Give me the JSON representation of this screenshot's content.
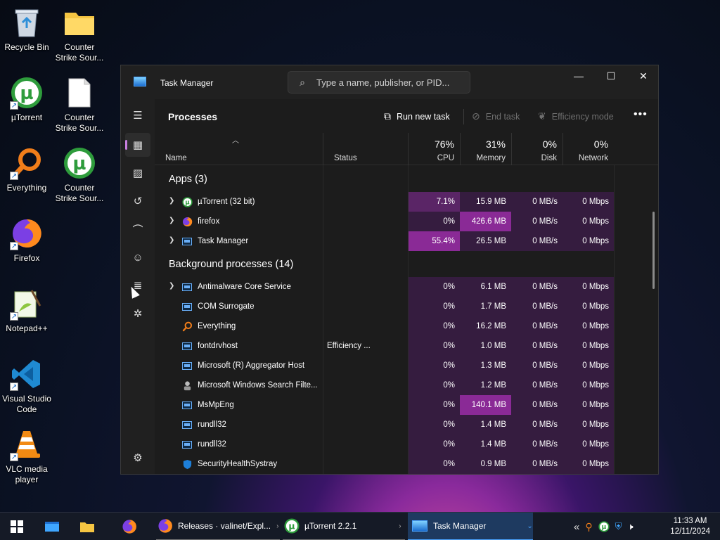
{
  "desktop": {
    "icons": [
      {
        "label": "Recycle Bin",
        "icon": "recycle-bin-icon"
      },
      {
        "label": "Counter Strike Sour...",
        "icon": "folder-icon"
      },
      {
        "label": "µTorrent",
        "icon": "utorrent-icon"
      },
      {
        "label": "Counter Strike Sour...",
        "icon": "document-icon"
      },
      {
        "label": "Everything",
        "icon": "everything-icon"
      },
      {
        "label": "Counter Strike Sour...",
        "icon": "utorrent-icon"
      },
      {
        "label": "Firefox",
        "icon": "firefox-icon"
      },
      {
        "label": "Notepad++",
        "icon": "notepad-plus-plus-icon"
      },
      {
        "label": "Visual Studio Code",
        "icon": "vscode-icon"
      },
      {
        "label": "VLC media player",
        "icon": "vlc-icon"
      }
    ]
  },
  "window": {
    "title": "Task Manager",
    "search_placeholder": "Type a name, publisher, or PID...",
    "controls": {
      "minimize": "—",
      "maximize": "☐",
      "close": "✕"
    }
  },
  "toolbar": {
    "heading": "Processes",
    "run_new_task": "Run new task",
    "end_task": "End task",
    "efficiency_mode": "Efficiency mode",
    "more": "•••"
  },
  "columns": {
    "name": "Name",
    "status": "Status",
    "cpu": {
      "pct": "76%",
      "label": "CPU"
    },
    "memory": {
      "pct": "31%",
      "label": "Memory"
    },
    "disk": {
      "pct": "0%",
      "label": "Disk"
    },
    "network": {
      "pct": "0%",
      "label": "Network"
    }
  },
  "groups": {
    "apps": "Apps (3)",
    "background": "Background processes (14)"
  },
  "apps": [
    {
      "name": "µTorrent (32 bit)",
      "status": "",
      "cpu": "7.1%",
      "memory": "15.9 MB",
      "disk": "0 MB/s",
      "network": "0 Mbps"
    },
    {
      "name": "firefox",
      "status": "",
      "cpu": "0%",
      "memory": "426.6 MB",
      "disk": "0 MB/s",
      "network": "0 Mbps"
    },
    {
      "name": "Task Manager",
      "status": "",
      "cpu": "55.4%",
      "memory": "26.5 MB",
      "disk": "0 MB/s",
      "network": "0 Mbps"
    }
  ],
  "background": [
    {
      "name": "Antimalware Core Service",
      "status": "",
      "cpu": "0%",
      "memory": "6.1 MB",
      "disk": "0 MB/s",
      "network": "0 Mbps"
    },
    {
      "name": "COM Surrogate",
      "status": "",
      "cpu": "0%",
      "memory": "1.7 MB",
      "disk": "0 MB/s",
      "network": "0 Mbps"
    },
    {
      "name": "Everything",
      "status": "",
      "cpu": "0%",
      "memory": "16.2 MB",
      "disk": "0 MB/s",
      "network": "0 Mbps"
    },
    {
      "name": "fontdrvhost",
      "status": "Efficiency ...",
      "cpu": "0%",
      "memory": "1.0 MB",
      "disk": "0 MB/s",
      "network": "0 Mbps"
    },
    {
      "name": "Microsoft (R) Aggregator Host",
      "status": "",
      "cpu": "0%",
      "memory": "1.3 MB",
      "disk": "0 MB/s",
      "network": "0 Mbps"
    },
    {
      "name": "Microsoft Windows Search Filte...",
      "status": "",
      "cpu": "0%",
      "memory": "1.2 MB",
      "disk": "0 MB/s",
      "network": "0 Mbps"
    },
    {
      "name": "MsMpEng",
      "status": "",
      "cpu": "0%",
      "memory": "140.1 MB",
      "disk": "0 MB/s",
      "network": "0 Mbps"
    },
    {
      "name": "rundll32",
      "status": "",
      "cpu": "0%",
      "memory": "1.4 MB",
      "disk": "0 MB/s",
      "network": "0 Mbps"
    },
    {
      "name": "rundll32",
      "status": "",
      "cpu": "0%",
      "memory": "1.4 MB",
      "disk": "0 MB/s",
      "network": "0 Mbps"
    },
    {
      "name": "SecurityHealthSystray",
      "status": "",
      "cpu": "0%",
      "memory": "0.9 MB",
      "disk": "0 MB/s",
      "network": "0 Mbps"
    }
  ],
  "taskbar": {
    "items": [
      {
        "label": "Releases · valinet/Expl..."
      },
      {
        "label": "µTorrent 2.2.1"
      },
      {
        "label": "Task Manager"
      }
    ],
    "time": "11:33 AM",
    "date": "12/11/2024"
  },
  "colors": {
    "heat_high": "#8a2a96",
    "heat_mid": "#5a2566",
    "heat_low": "#351c3f",
    "accent": "#c97fe0"
  }
}
